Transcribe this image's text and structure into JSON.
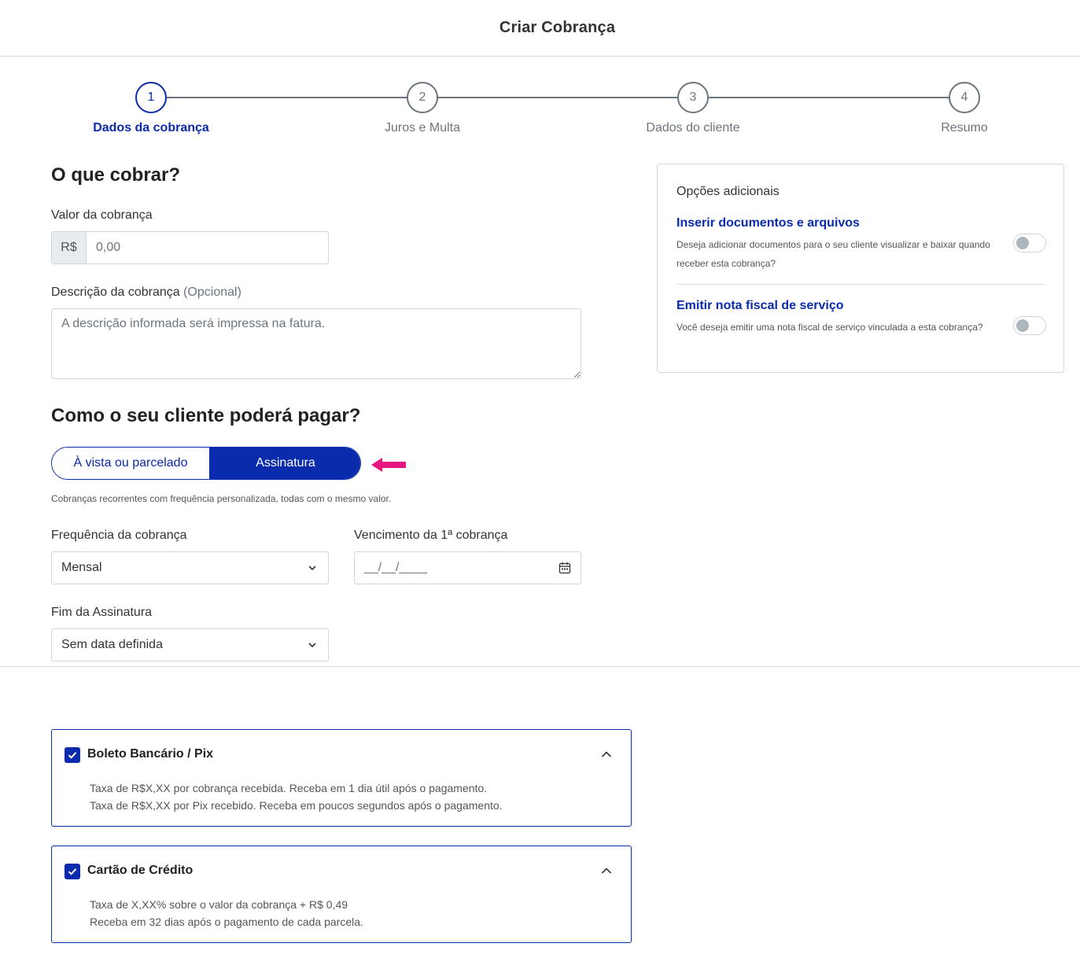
{
  "header": {
    "title": "Criar Cobrança"
  },
  "stepper": {
    "steps": [
      {
        "number": "1",
        "label": "Dados da cobrança"
      },
      {
        "number": "2",
        "label": "Juros e Multa"
      },
      {
        "number": "3",
        "label": "Dados do cliente"
      },
      {
        "number": "4",
        "label": "Resumo"
      }
    ],
    "active_step": 1
  },
  "what": {
    "title": "O que cobrar?",
    "amount_label": "Valor da cobrança",
    "amount_prefix": "R$",
    "amount_placeholder": "0,00",
    "description_label": "Descrição da cobrança",
    "description_optional": "(Opcional)",
    "description_placeholder": "A descrição informada será impressa na fatura."
  },
  "how": {
    "title": "Como o seu cliente poderá pagar?",
    "options": [
      "À vista ou parcelado",
      "Assinatura"
    ],
    "selected": "Assinatura",
    "hint": "Cobranças recorrentes com frequência personalizada, todas com o mesmo valor.",
    "frequency_label": "Frequência da cobrança",
    "frequency_value": "Mensal",
    "due_label": "Vencimento da 1ª cobrança",
    "due_placeholder": "__/__/____",
    "end_label": "Fim da Assinatura",
    "end_value": "Sem data definida"
  },
  "payment_methods": [
    {
      "title": "Boleto Bancário / Pix",
      "checked": true,
      "lines": [
        "Taxa de R$X,XX por cobrança recebida. Receba em 1 dia útil após o pagamento.",
        "Taxa de R$X,XX por Pix recebido. Receba em poucos segundos após o pagamento."
      ]
    },
    {
      "title": "Cartão de Crédito",
      "checked": true,
      "lines": [
        "Taxa de X,XX% sobre o valor da cobrança + R$ 0,49",
        "Receba em 32 dias após o pagamento de cada parcela."
      ]
    }
  ],
  "additional": {
    "title": "Opções adicionais",
    "items": [
      {
        "name": "Inserir documentos e arquivos",
        "text": "Deseja adicionar documentos para o seu cliente visualizar e baixar quando receber esta cobrança?",
        "enabled": false
      },
      {
        "name": "Emitir nota fiscal de serviço",
        "text": "Você deseja emitir uma nota fiscal de serviço vinculada a esta cobrança?",
        "enabled": false
      }
    ]
  },
  "colors": {
    "primary": "#0a2bab",
    "arrow": "#e6157f",
    "muted": "#6c757d"
  }
}
